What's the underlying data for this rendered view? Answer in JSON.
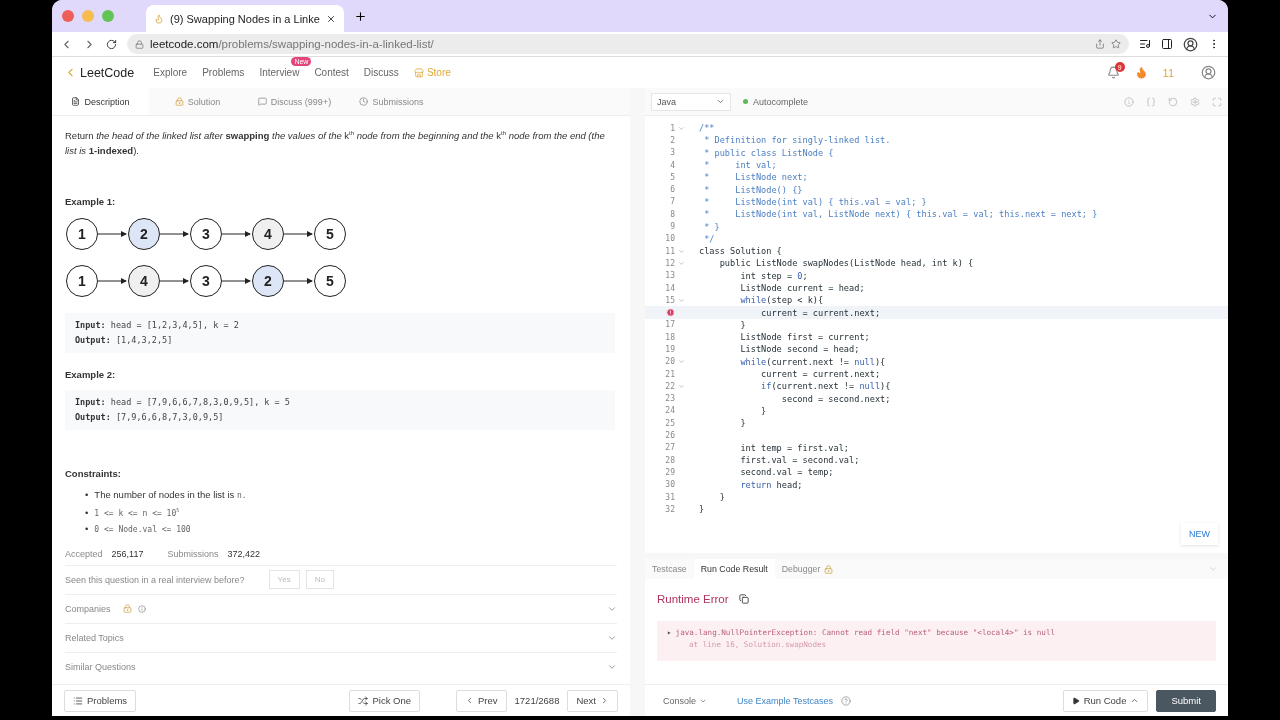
{
  "browser": {
    "tab_title": "(9) Swapping Nodes in a Linke",
    "url_host": "leetcode.com",
    "url_path": "/problems/swapping-nodes-in-a-linked-list/"
  },
  "nav": {
    "logo": "LeetCode",
    "items": [
      {
        "label": "Explore",
        "kind": "link"
      },
      {
        "label": "Problems",
        "kind": "link"
      },
      {
        "label": "Interview",
        "badge": "New",
        "kind": "link"
      },
      {
        "label": "Contest",
        "kind": "link"
      },
      {
        "label": "Discuss",
        "kind": "link"
      },
      {
        "label": "Store",
        "kind": "store"
      }
    ],
    "notifications": "9",
    "streak": "11"
  },
  "panel_tabs": [
    {
      "label": "Description",
      "selected": true
    },
    {
      "label": "Solution",
      "selected": false
    },
    {
      "label": "Discuss (999+)",
      "selected": false
    },
    {
      "label": "Submissions",
      "selected": false
    }
  ],
  "description": "Return *the head of the linked list after* **swapping** *the values of the* k$^{th}$ *node from the beginning and the* k$^{th}$ *node from the end (the list is* **1-indexed**).",
  "examples": [
    {
      "title": "Example 1:",
      "diagram": [
        [
          {
            "label": "1",
            "color": "#ffffff"
          },
          {
            "label": "2",
            "color": "#dce6f7"
          },
          {
            "label": "3",
            "color": "#ffffff"
          },
          {
            "label": "4",
            "color": "#f0f0f0"
          },
          {
            "label": "5",
            "color": "#ffffff"
          }
        ],
        [
          {
            "label": "1",
            "color": "#ffffff"
          },
          {
            "label": "4",
            "color": "#f0f0f0"
          },
          {
            "label": "3",
            "color": "#ffffff"
          },
          {
            "label": "2",
            "color": "#dce6f7"
          },
          {
            "label": "5",
            "color": "#ffffff"
          }
        ]
      ],
      "input_label": "Input:",
      "input": "head = [1,2,3,4,5], k = 2",
      "output_label": "Output:",
      "output": "[1,4,3,2,5]"
    },
    {
      "title": "Example 2:",
      "input_label": "Input:",
      "input": "head = [7,9,6,6,7,8,3,0,9,5], k = 5",
      "output_label": "Output:",
      "output": "[7,9,6,6,8,7,3,0,9,5]"
    }
  ],
  "constraints": {
    "title": "Constraints:",
    "items": [
      {
        "kind": "text",
        "marker": "•",
        "text": "The number of nodes in the list is",
        "code": "n."
      },
      {
        "kind": "code",
        "marker": "•",
        "text": "1 <= k <= n <= 10$^{5}$"
      },
      {
        "kind": "code",
        "marker": "•",
        "text": "0 <= Node.val <= 100"
      }
    ]
  },
  "stats": [
    {
      "label": "Accepted",
      "value": "256,117"
    },
    {
      "label": "Submissions",
      "value": "372,422"
    }
  ],
  "interview_question": {
    "text": "Seen this question in a real interview before?",
    "buttons": [
      "Yes",
      "No"
    ]
  },
  "accordions": [
    {
      "label": "Companies",
      "locked": true
    },
    {
      "label": "Related Topics",
      "locked": false
    },
    {
      "label": "Similar Questions",
      "locked": false
    }
  ],
  "left_footer": {
    "problems": "Problems",
    "pick_one": "Pick One",
    "prev": "Prev",
    "counter": "1721/2688",
    "next": "Next"
  },
  "editor": {
    "language": "Java",
    "autocomplete": "Autocomplete",
    "autocomplete_on": true,
    "new_button": "NEW",
    "lines": [
      {
        "n": "1",
        "fold": true,
        "segs": [
          {
            "kind": "comment",
            "t": "/**"
          }
        ]
      },
      {
        "n": "2",
        "segs": [
          {
            "kind": "comment",
            "t": " * Definition for singly-linked list."
          }
        ]
      },
      {
        "n": "3",
        "segs": [
          {
            "kind": "comment",
            "t": " * public class ListNode {"
          }
        ]
      },
      {
        "n": "4",
        "segs": [
          {
            "kind": "comment",
            "t": " *     int val;"
          }
        ]
      },
      {
        "n": "5",
        "segs": [
          {
            "kind": "comment",
            "t": " *     ListNode next;"
          }
        ]
      },
      {
        "n": "6",
        "segs": [
          {
            "kind": "comment",
            "t": " *     ListNode() {}"
          }
        ]
      },
      {
        "n": "7",
        "segs": [
          {
            "kind": "comment",
            "t": " *     ListNode(int val) { this.val = val; }"
          }
        ]
      },
      {
        "n": "8",
        "segs": [
          {
            "kind": "comment",
            "t": " *     ListNode(int val, ListNode next) { this.val = val; this.next = next; }"
          }
        ]
      },
      {
        "n": "9",
        "segs": [
          {
            "kind": "comment",
            "t": " * }"
          }
        ]
      },
      {
        "n": "10",
        "segs": [
          {
            "kind": "comment",
            "t": " */"
          }
        ]
      },
      {
        "n": "11",
        "fold": true,
        "segs": [
          {
            "kind": "code",
            "t": "class Solution {"
          }
        ]
      },
      {
        "n": "12",
        "fold": true,
        "segs": [
          {
            "kind": "code",
            "t": "    public ListNode swapNodes(ListNode head, int k) {"
          }
        ]
      },
      {
        "n": "13",
        "segs": [
          {
            "kind": "code",
            "t": "        int step = "
          },
          {
            "kind": "keyword",
            "t": "0"
          },
          {
            "kind": "code",
            "t": ";"
          }
        ]
      },
      {
        "n": "14",
        "segs": [
          {
            "kind": "code",
            "t": "        ListNode current = head;"
          }
        ]
      },
      {
        "n": "15",
        "fold": true,
        "segs": [
          {
            "kind": "keyword",
            "t": "        while"
          },
          {
            "kind": "code",
            "t": "(step < k){"
          }
        ]
      },
      {
        "error": true,
        "current": true,
        "segs": [
          {
            "kind": "code",
            "t": "            current = current.next;"
          }
        ]
      },
      {
        "n": "17",
        "segs": [
          {
            "kind": "code",
            "t": "        }"
          }
        ]
      },
      {
        "n": "18",
        "segs": [
          {
            "kind": "code",
            "t": "        ListNode first = current;"
          }
        ]
      },
      {
        "n": "19",
        "segs": [
          {
            "kind": "code",
            "t": "        ListNode second = head;"
          }
        ]
      },
      {
        "n": "20",
        "fold": true,
        "segs": [
          {
            "kind": "keyword",
            "t": "        while"
          },
          {
            "kind": "code",
            "t": "(current.next != "
          },
          {
            "kind": "keyword",
            "t": "null"
          },
          {
            "kind": "code",
            "t": "){"
          }
        ]
      },
      {
        "n": "21",
        "segs": [
          {
            "kind": "code",
            "t": "            current = current.next;"
          }
        ]
      },
      {
        "n": "22",
        "fold": true,
        "segs": [
          {
            "kind": "keyword",
            "t": "            if"
          },
          {
            "kind": "code",
            "t": "(current.next != "
          },
          {
            "kind": "keyword",
            "t": "null"
          },
          {
            "kind": "code",
            "t": "){"
          }
        ]
      },
      {
        "n": "23",
        "segs": [
          {
            "kind": "code",
            "t": "                second = second.next;"
          }
        ]
      },
      {
        "n": "24",
        "segs": [
          {
            "kind": "code",
            "t": "            }"
          }
        ]
      },
      {
        "n": "25",
        "segs": [
          {
            "kind": "code",
            "t": "        }"
          }
        ]
      },
      {
        "n": "26"
      },
      {
        "n": "27",
        "segs": [
          {
            "kind": "code",
            "t": "        int temp = first.val;"
          }
        ]
      },
      {
        "n": "28",
        "segs": [
          {
            "kind": "code",
            "t": "        first.val = second.val;"
          }
        ]
      },
      {
        "n": "29",
        "segs": [
          {
            "kind": "code",
            "t": "        second.val = temp;"
          }
        ]
      },
      {
        "n": "30",
        "segs": [
          {
            "kind": "keyword",
            "t": "        return"
          },
          {
            "kind": "code",
            "t": " head;"
          }
        ]
      },
      {
        "n": "31",
        "segs": [
          {
            "kind": "code",
            "t": "    }"
          }
        ]
      },
      {
        "n": "32",
        "segs": [
          {
            "kind": "code",
            "t": "}"
          }
        ]
      }
    ]
  },
  "result_tabs": [
    {
      "label": "Testcase",
      "selected": false,
      "locked": false
    },
    {
      "label": "Run Code Result",
      "selected": true,
      "locked": false
    },
    {
      "label": "Debugger",
      "selected": false,
      "locked": true
    }
  ],
  "result": {
    "title": "Runtime Error",
    "toggle": "▸",
    "lines": [
      "java.lang.NullPointerException: Cannot read field \"next\" because \"<local4>\" is null",
      "at line 16, Solution.swapNodes"
    ]
  },
  "right_footer": {
    "console": "Console",
    "example": "Use Example Testcases",
    "run": "Run Code",
    "submit": "Submit"
  }
}
